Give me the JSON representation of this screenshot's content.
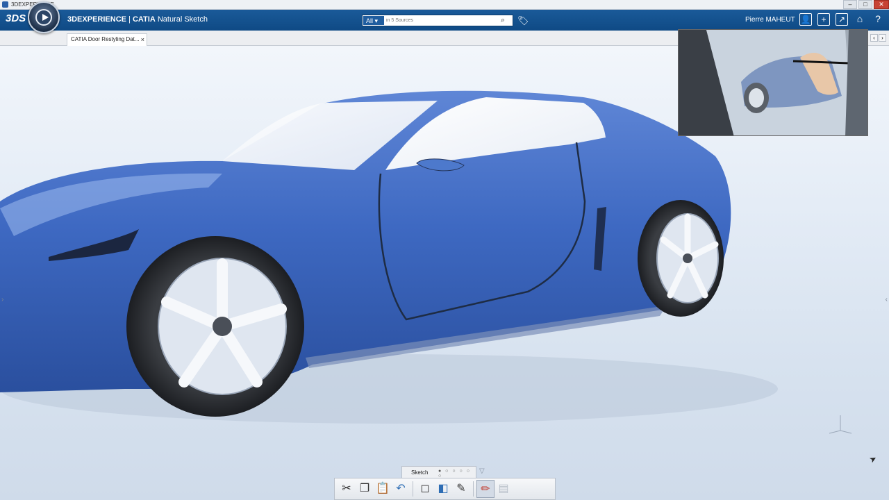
{
  "os_window": {
    "title": "3DEXPERIENCE",
    "controls": [
      "–",
      "□",
      "✕"
    ]
  },
  "top_bar": {
    "brand": "3DEXPERIENCE",
    "separator": " | ",
    "product": "CATIA",
    "app_name": "Natural Sketch",
    "search": {
      "scope": "All",
      "placeholder": "in 5 Sources"
    },
    "user_name": "Pierre MAHEUT",
    "icons": [
      "user-icon",
      "add-icon",
      "share-icon",
      "home-icon",
      "help-icon"
    ]
  },
  "tab_strip": {
    "active_tab_label": "CATIA Door Restyling Dat...",
    "close_label": "×"
  },
  "section_bar": {
    "active_section": "Sketch",
    "page_dots": "● ○ ○ ○ ○ ○"
  },
  "action_bar": {
    "tools": [
      {
        "name": "cut-icon",
        "glyph": "✂"
      },
      {
        "name": "copy-icon",
        "glyph": "❐"
      },
      {
        "name": "paste-icon",
        "glyph": "📋"
      },
      {
        "name": "undo-icon",
        "glyph": "↶"
      },
      {
        "name": "erase-icon",
        "glyph": "◻"
      },
      {
        "name": "fill-icon",
        "glyph": "◧"
      },
      {
        "name": "brush-icon",
        "glyph": "✎"
      },
      {
        "name": "pencil-icon",
        "glyph": "✏"
      },
      {
        "name": "layers-icon",
        "glyph": "▤"
      }
    ]
  },
  "colors": {
    "top_bar": "#0f4a85",
    "car_body": "#3e69c2",
    "accent": "#1f5d9f"
  }
}
